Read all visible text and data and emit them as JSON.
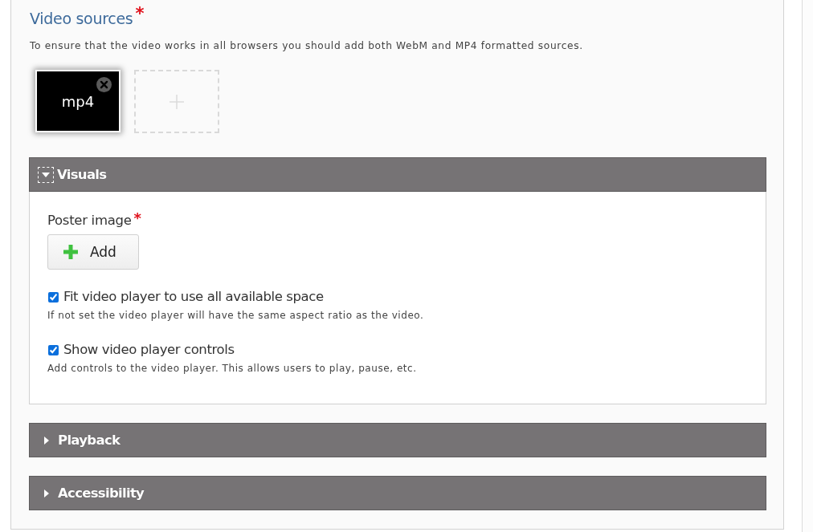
{
  "video_sources": {
    "label": "Video sources",
    "required_mark": "*",
    "description": "To ensure that the video works in all browsers you should add both WebM and MP4 formatted sources.",
    "sources": [
      {
        "label": "mp4"
      }
    ]
  },
  "sections": [
    {
      "title": "Visuals",
      "expanded": true,
      "focused": true,
      "poster": {
        "label": "Poster image",
        "required_mark": "*",
        "button": "Add"
      },
      "options": [
        {
          "label": "Fit video player to use all available space",
          "checked": true,
          "description": "If not set the video player will have the same aspect ratio as the video."
        },
        {
          "label": "Show video player controls",
          "checked": true,
          "description": "Add controls to the video player. This allows users to play, pause, etc."
        }
      ]
    },
    {
      "title": "Playback",
      "expanded": false,
      "focused": false
    },
    {
      "title": "Accessibility",
      "expanded": false,
      "focused": false
    }
  ]
}
